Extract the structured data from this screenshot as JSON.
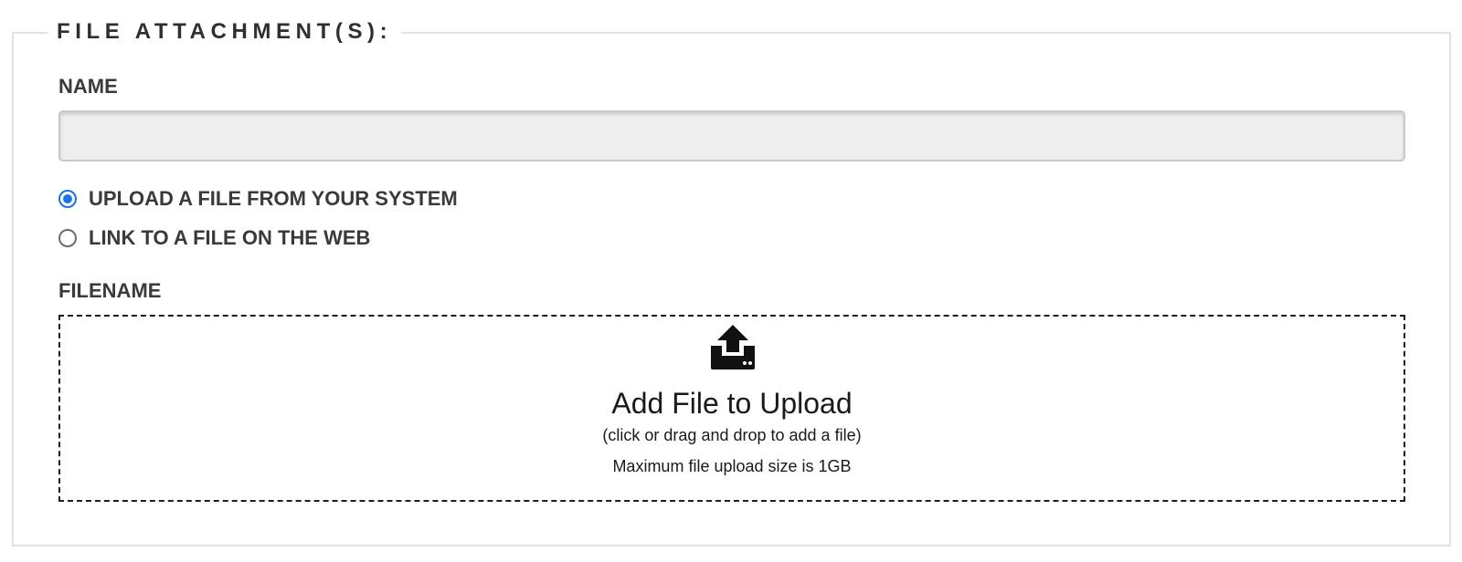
{
  "fieldset": {
    "legend": "FILE ATTACHMENT(S):"
  },
  "name_field": {
    "label": "NAME",
    "value": "",
    "placeholder": ""
  },
  "source_options": [
    {
      "label": "UPLOAD A FILE FROM YOUR SYSTEM",
      "selected": true
    },
    {
      "label": "LINK TO A FILE ON THE WEB",
      "selected": false
    }
  ],
  "filename": {
    "label": "FILENAME"
  },
  "dropzone": {
    "icon": "upload-icon",
    "title": "Add File to Upload",
    "subtitle": "(click or drag and drop to add a file)",
    "max_size_note": "Maximum file upload size is 1GB"
  },
  "colors": {
    "radio_accent": "#1a73e8",
    "text": "#3a3a3a",
    "border": "#e2e2e2",
    "input_bg": "#eeeeee"
  }
}
